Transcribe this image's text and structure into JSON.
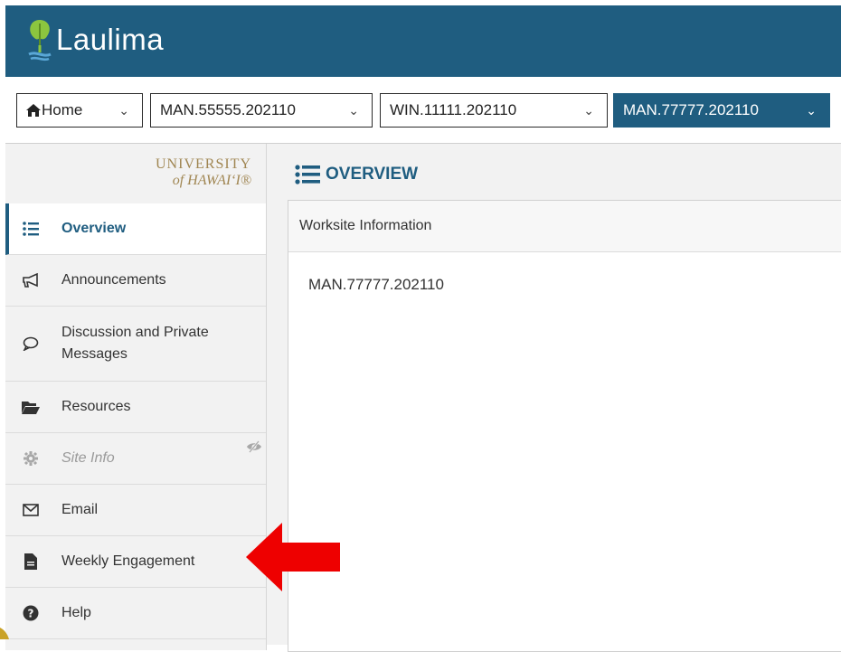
{
  "app": {
    "name": "Laulima"
  },
  "tabs": [
    {
      "label": "Home",
      "active": false
    },
    {
      "label": "MAN.55555.202110",
      "active": false
    },
    {
      "label": "WIN.11111.202110",
      "active": false
    },
    {
      "label": "MAN.77777.202110",
      "active": true
    }
  ],
  "university": {
    "line1": "UNIVERSITY",
    "line2": "of HAWAIʻI®"
  },
  "sidebar": {
    "items": [
      {
        "label": "Overview",
        "icon": "list-icon",
        "active": true
      },
      {
        "label": "Announcements",
        "icon": "megaphone-icon"
      },
      {
        "label": "Discussion and Private Messages",
        "icon": "chat-bubble-icon"
      },
      {
        "label": "Resources",
        "icon": "folder-open-icon"
      },
      {
        "label": "Site Info",
        "icon": "gear-icon",
        "hidden": true
      },
      {
        "label": "Email",
        "icon": "envelope-icon"
      },
      {
        "label": "Weekly Engagement",
        "icon": "document-icon"
      },
      {
        "label": "Help",
        "icon": "question-circle-icon"
      }
    ]
  },
  "main": {
    "title": "OVERVIEW",
    "panel_header": "Worksite Information",
    "panel_body": "MAN.77777.202110"
  },
  "colors": {
    "brand": "#1f5d80",
    "arrow": "#ee0000",
    "uh_gold": "#a08652"
  }
}
